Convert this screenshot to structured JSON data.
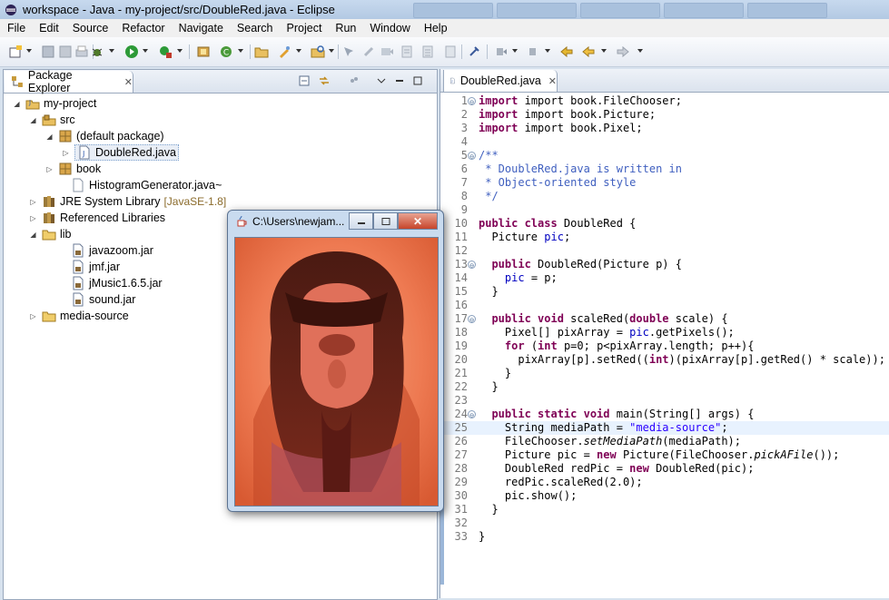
{
  "window": {
    "title": "workspace - Java - my-project/src/DoubleRed.java - Eclipse"
  },
  "menu": [
    "File",
    "Edit",
    "Source",
    "Refactor",
    "Navigate",
    "Search",
    "Project",
    "Run",
    "Window",
    "Help"
  ],
  "package_explorer": {
    "tab_label": "Package Explorer",
    "tree": [
      {
        "label": "my-project",
        "icon": "java-project-icon"
      },
      {
        "label": "src",
        "icon": "source-folder-icon"
      },
      {
        "label": "(default package)",
        "icon": "package-icon"
      },
      {
        "label": "DoubleRed.java",
        "icon": "java-file-icon",
        "selected": true
      },
      {
        "label": "book",
        "icon": "package-icon"
      },
      {
        "label": "HistogramGenerator.java~",
        "icon": "file-icon"
      },
      {
        "label": "JRE System Library",
        "decoration": "[JavaSE-1.8]",
        "icon": "library-icon"
      },
      {
        "label": "Referenced Libraries",
        "icon": "library-icon"
      },
      {
        "label": "lib",
        "icon": "folder-icon"
      },
      {
        "label": "javazoom.jar",
        "icon": "jar-icon"
      },
      {
        "label": "jmf.jar",
        "icon": "jar-icon"
      },
      {
        "label": "jMusic1.6.5.jar",
        "icon": "jar-icon"
      },
      {
        "label": "sound.jar",
        "icon": "jar-icon"
      },
      {
        "label": "media-source",
        "icon": "folder-icon"
      }
    ]
  },
  "editor": {
    "tab_label": "DoubleRed.java",
    "lines": [
      "1",
      "2",
      "3",
      "4",
      "5",
      "6",
      "7",
      "8",
      "9",
      "10",
      "11",
      "12",
      "13",
      "14",
      "15",
      "16",
      "17",
      "18",
      "19",
      "20",
      "21",
      "22",
      "23",
      "24",
      "25",
      "26",
      "27",
      "28",
      "29",
      "30",
      "31",
      "32",
      "33"
    ],
    "code": {
      "l1": "import book.FileChooser;",
      "l2": "import book.Picture;",
      "l3": "import book.Pixel;",
      "l5": "/**",
      "l6": " * DoubleRed.java is written in",
      "l7": " * Object-oriented style",
      "l8": " */",
      "l10a": "public class",
      "l10b": " DoubleRed {",
      "l11a": "  Picture ",
      "l11b": "pic",
      "l11c": ";",
      "l13a": "  public",
      "l13b": " DoubleRed(Picture p) {",
      "l14a": "    ",
      "l14b": "pic",
      "l14c": " = p;",
      "l15": "  }",
      "l17a": "  public void",
      "l17b": " scaleRed(",
      "l17c": "double",
      "l17d": " scale) {",
      "l18a": "    Pixel[] pixArray = ",
      "l18b": "pic",
      "l18c": ".getPixels();",
      "l19a": "    ",
      "l19b": "for",
      "l19c": " (",
      "l19d": "int",
      "l19e": " p=0; p<pixArray.length; p++){",
      "l20a": "      pixArray[p].setRed((",
      "l20b": "int",
      "l20c": ")(pixArray[p].getRed() * scale));",
      "l21": "    }",
      "l22": "  }",
      "l24a": "  public static void",
      "l24b": " main(String[] args) {",
      "l25a": "    String mediaPath = ",
      "l25b": "\"media-source\"",
      "l25c": ";",
      "l26a": "    FileChooser.",
      "l26b": "setMediaPath",
      "l26c": "(mediaPath);",
      "l27a": "    Picture pic = ",
      "l27b": "new",
      "l27c": " Picture(FileChooser.",
      "l27d": "pickAFile",
      "l27e": "());",
      "l28a": "    DoubleRed redPic = ",
      "l28b": "new",
      "l28c": " DoubleRed(pic);",
      "l29": "    redPic.scaleRed(2.0);",
      "l30": "    pic.show();",
      "l31": "  }",
      "l33": "}"
    }
  },
  "picture_window": {
    "title": "C:\\Users\\newjam..."
  },
  "colors": {
    "keyword": "#7f0055",
    "comment": "#3f5fbf",
    "field": "#0000c0",
    "string": "#2a00ff"
  }
}
